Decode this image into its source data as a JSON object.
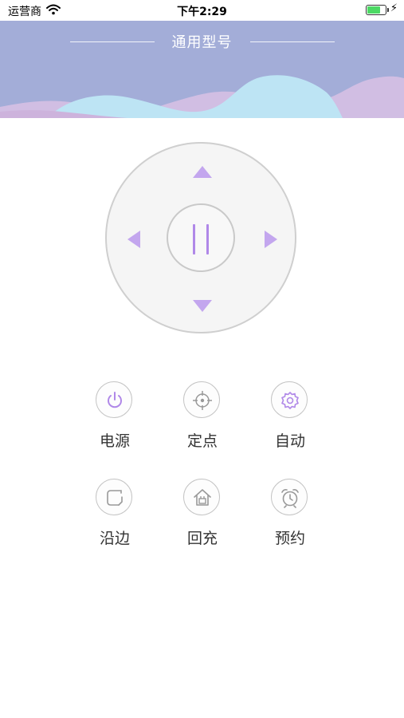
{
  "status_bar": {
    "carrier": "运营商",
    "time": "下午2:29",
    "battery_level": 0.78
  },
  "header": {
    "title": "通用型号"
  },
  "colors": {
    "accent": "#b088e8",
    "arrow": "#c3a6ee",
    "header_bg": "#a3add8",
    "wave_blue": "#bde4f4",
    "wave_purple": "#d1bee3",
    "battery": "#4cd964"
  },
  "dpad": {
    "up_icon": "triangle-up-icon",
    "down_icon": "triangle-down-icon",
    "left_icon": "triangle-left-icon",
    "right_icon": "triangle-right-icon",
    "center_icon": "pause-icon"
  },
  "functions": [
    {
      "label": "电源",
      "icon": "power-icon"
    },
    {
      "label": "定点",
      "icon": "crosshair-icon"
    },
    {
      "label": "自动",
      "icon": "gear-icon"
    },
    {
      "label": "沿边",
      "icon": "edge-icon"
    },
    {
      "label": "回充",
      "icon": "home-charge-icon"
    },
    {
      "label": "预约",
      "icon": "alarm-clock-icon"
    }
  ]
}
